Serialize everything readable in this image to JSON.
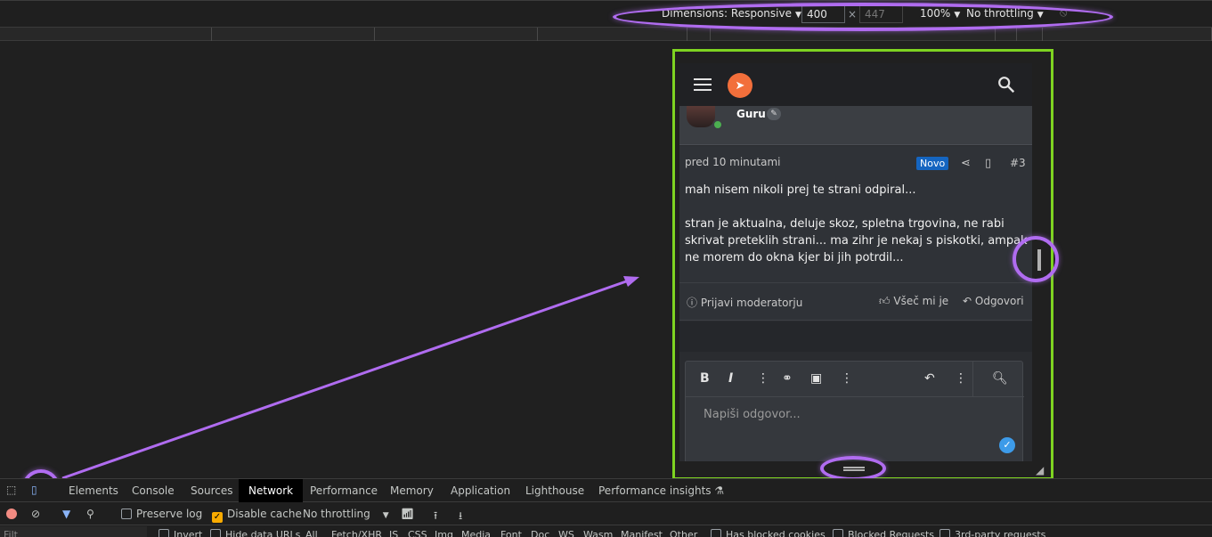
{
  "device_toolbar": {
    "dimensions_label": "Dimensions: Responsive",
    "width": "400",
    "times": "×",
    "height_placeholder": "447",
    "zoom": "100%",
    "throttling": "No throttling"
  },
  "app": {
    "user": {
      "name": "Guru"
    },
    "post": {
      "time": "pred 10 minutami",
      "badge": "Novo",
      "number": "#3",
      "paragraphs": [
        "mah nisem nikoli prej te strani odpiral...",
        "stran je aktualna, deluje skoz, spletna trgovina, ne rabi skrivat preteklih strani... ma zihr je nekaj s piskotki, ampak ne morem do okna kjer bi jih potrdil..."
      ]
    },
    "actions": {
      "report": "Prijavi moderatorju",
      "like": "Všeč mi je",
      "reply": "Odgovori"
    },
    "editor": {
      "placeholder": "Napiši odgovor..."
    }
  },
  "devtools": {
    "tabs": [
      "Elements",
      "Console",
      "Sources",
      "Network",
      "Performance",
      "Memory",
      "Application",
      "Lighthouse",
      "Performance insights"
    ],
    "active_tab": "Network",
    "network": {
      "preserve_log": "Preserve log",
      "disable_cache": "Disable cache",
      "throttling": "No throttling"
    },
    "filter_row": {
      "filter": "Filt",
      "invert": "Invert",
      "hide_data_urls": "Hide data URLs",
      "types": [
        "All",
        "Fetch/XHR",
        "JS",
        "CSS",
        "Img",
        "Media",
        "Font",
        "Doc",
        "WS",
        "Wasm",
        "Manifest",
        "Other"
      ],
      "blocked_cookies": "Has blocked cookies",
      "blocked_requests": "Blocked Requests",
      "third_party": "3rd-party requests"
    }
  },
  "colors": {
    "highlight": "#b06cf0",
    "frame": "#7ed321",
    "accent_logo": "#f26f3b",
    "badge": "#1565c0"
  }
}
